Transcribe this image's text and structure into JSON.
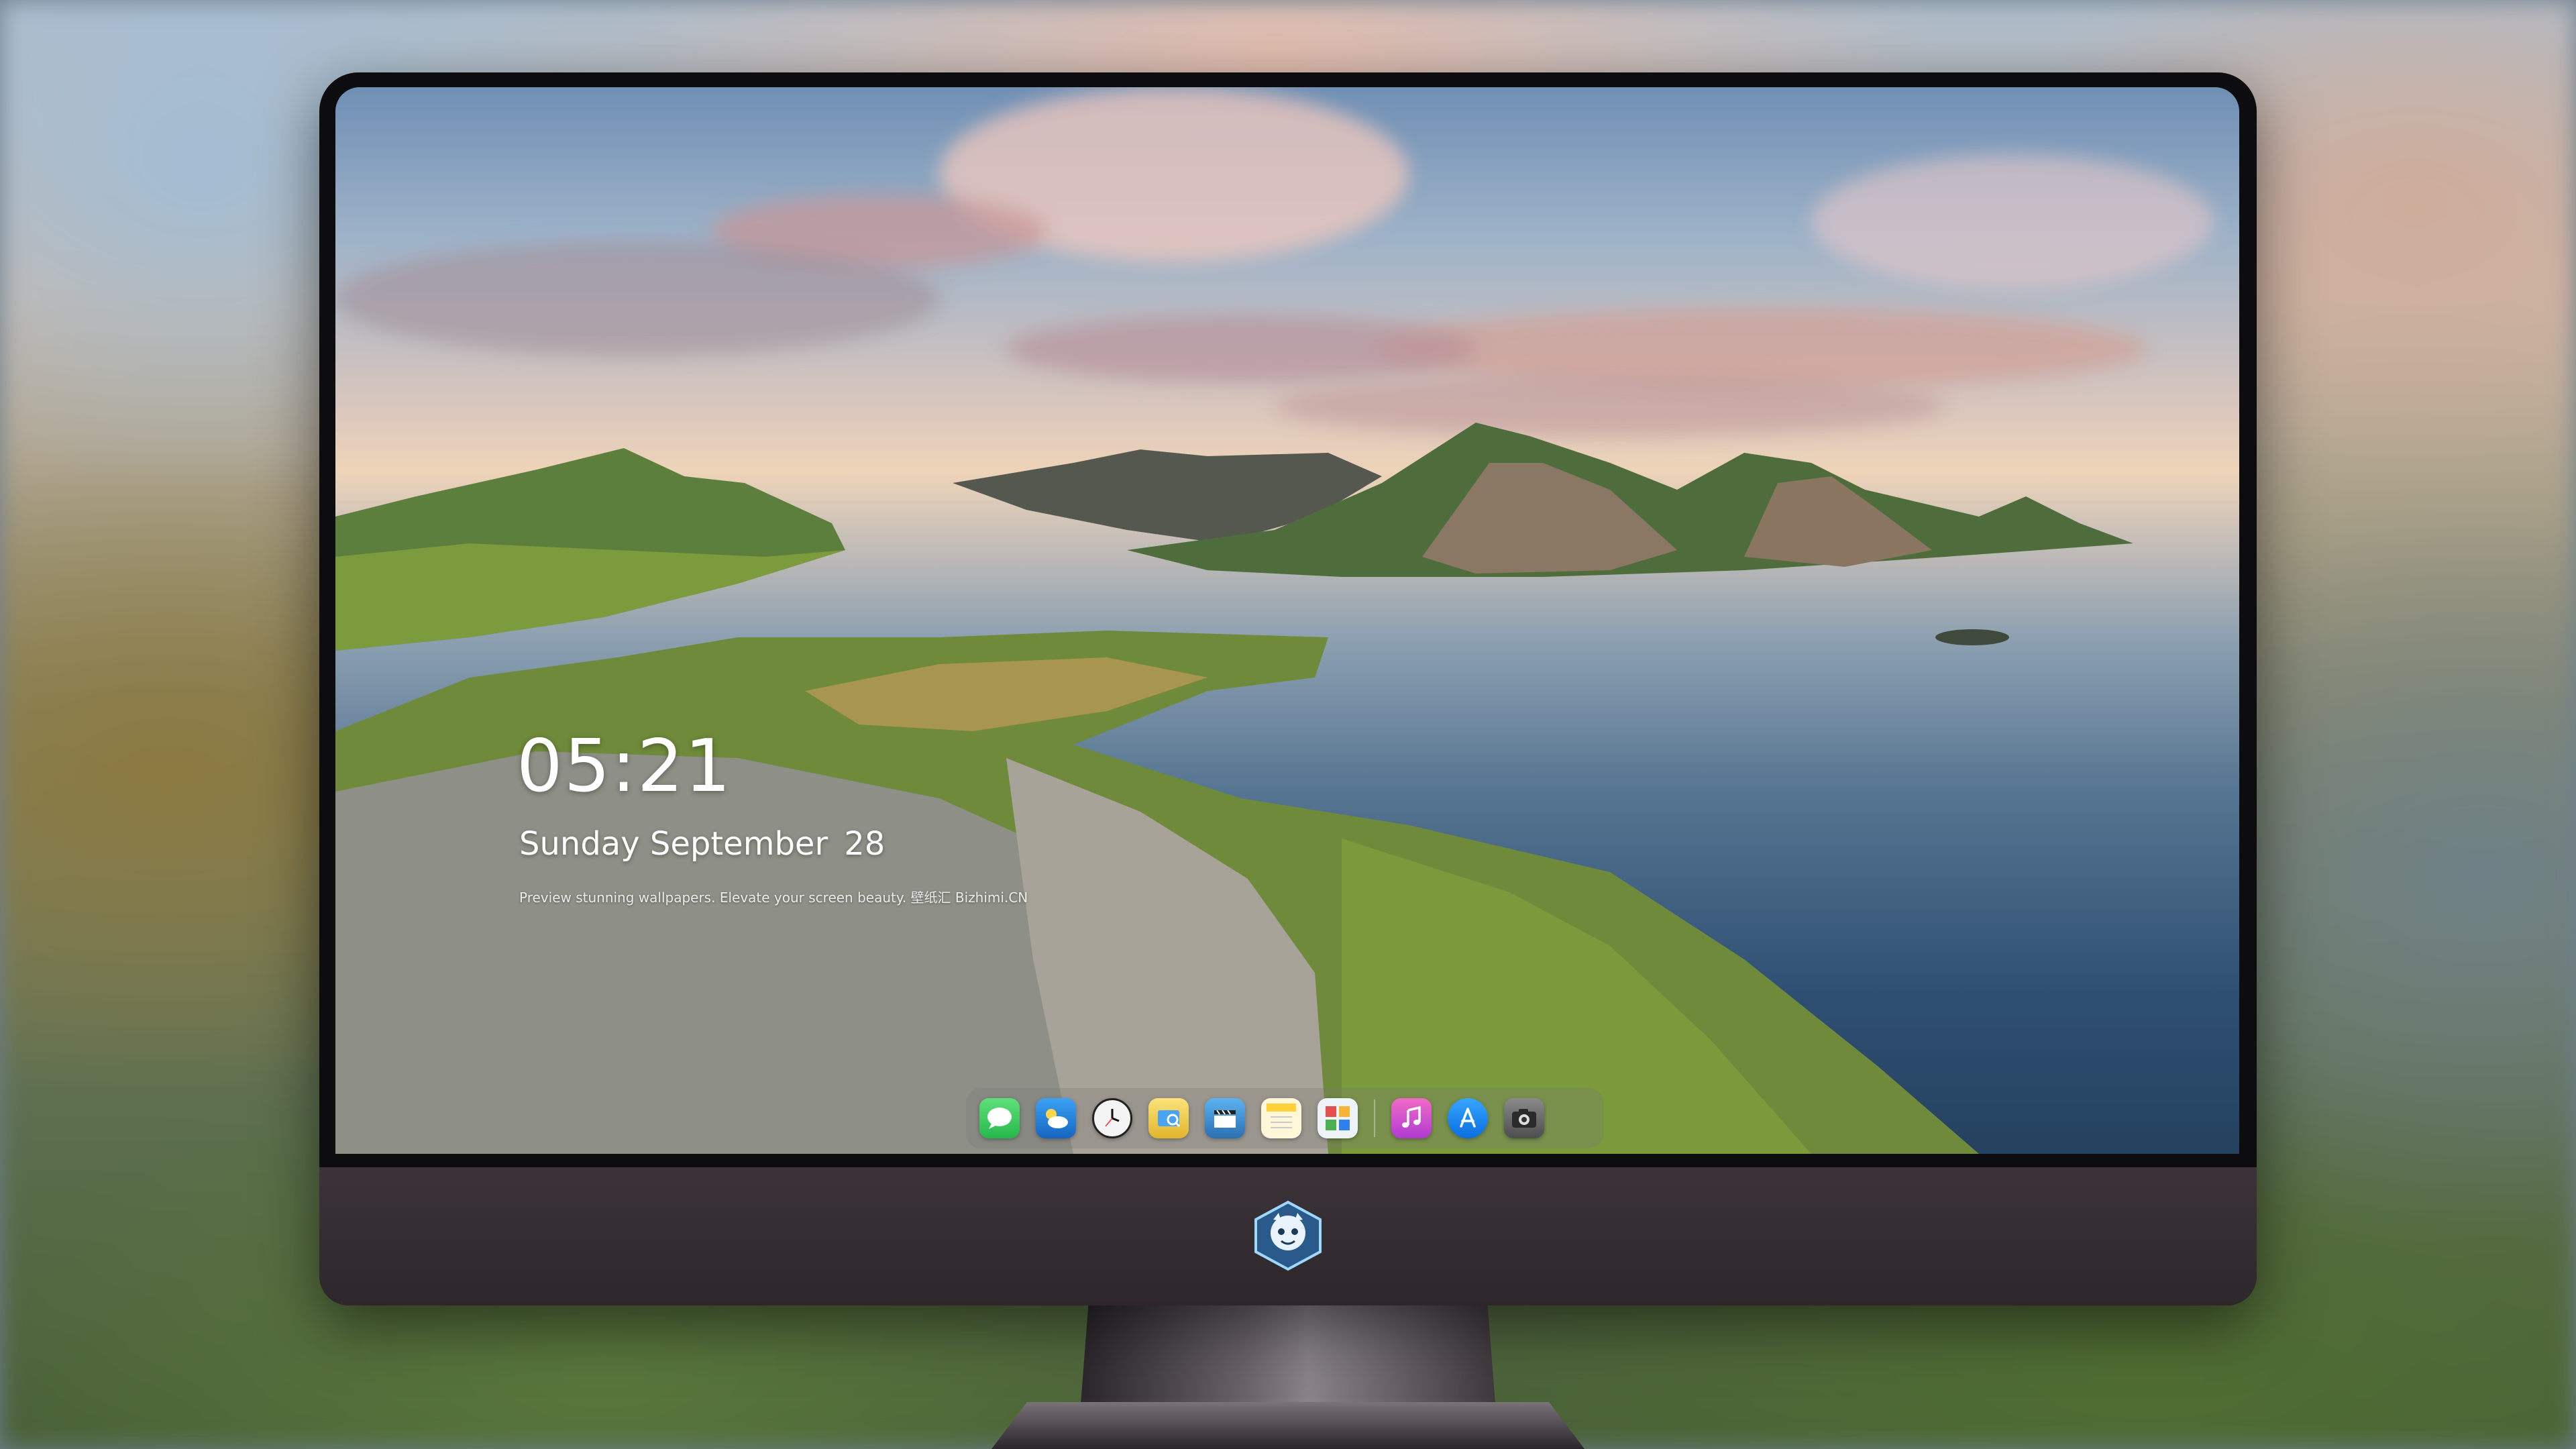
{
  "lockscreen": {
    "time": "05:21",
    "day": "Sunday",
    "month": "September",
    "date": "28",
    "tagline": "Preview stunning wallpapers. Elevate your screen beauty. 壁纸汇 Bizhimi.CN"
  },
  "dock": {
    "apps": [
      {
        "name": "messages",
        "icon": "messages-icon",
        "color": "#34c759"
      },
      {
        "name": "weather",
        "icon": "weather-icon",
        "color": "#1e88e5"
      },
      {
        "name": "clock",
        "icon": "clock-icon",
        "color": "#ffffff"
      },
      {
        "name": "preview",
        "icon": "preview-icon",
        "color": "#f5d547"
      },
      {
        "name": "final-cut",
        "icon": "clapper-icon",
        "color": "#3a86c8"
      },
      {
        "name": "notes",
        "icon": "notes-icon",
        "color": "#ffd84a"
      },
      {
        "name": "photo-booth",
        "icon": "photo-grid-icon",
        "color": "#e8eef3"
      },
      {
        "name": "music",
        "icon": "music-icon",
        "color": "#e04db5"
      },
      {
        "name": "app-store",
        "icon": "app-store-icon",
        "color": "#1a8cff"
      },
      {
        "name": "camera",
        "icon": "camera-icon",
        "color": "#6e6e6e"
      }
    ]
  }
}
